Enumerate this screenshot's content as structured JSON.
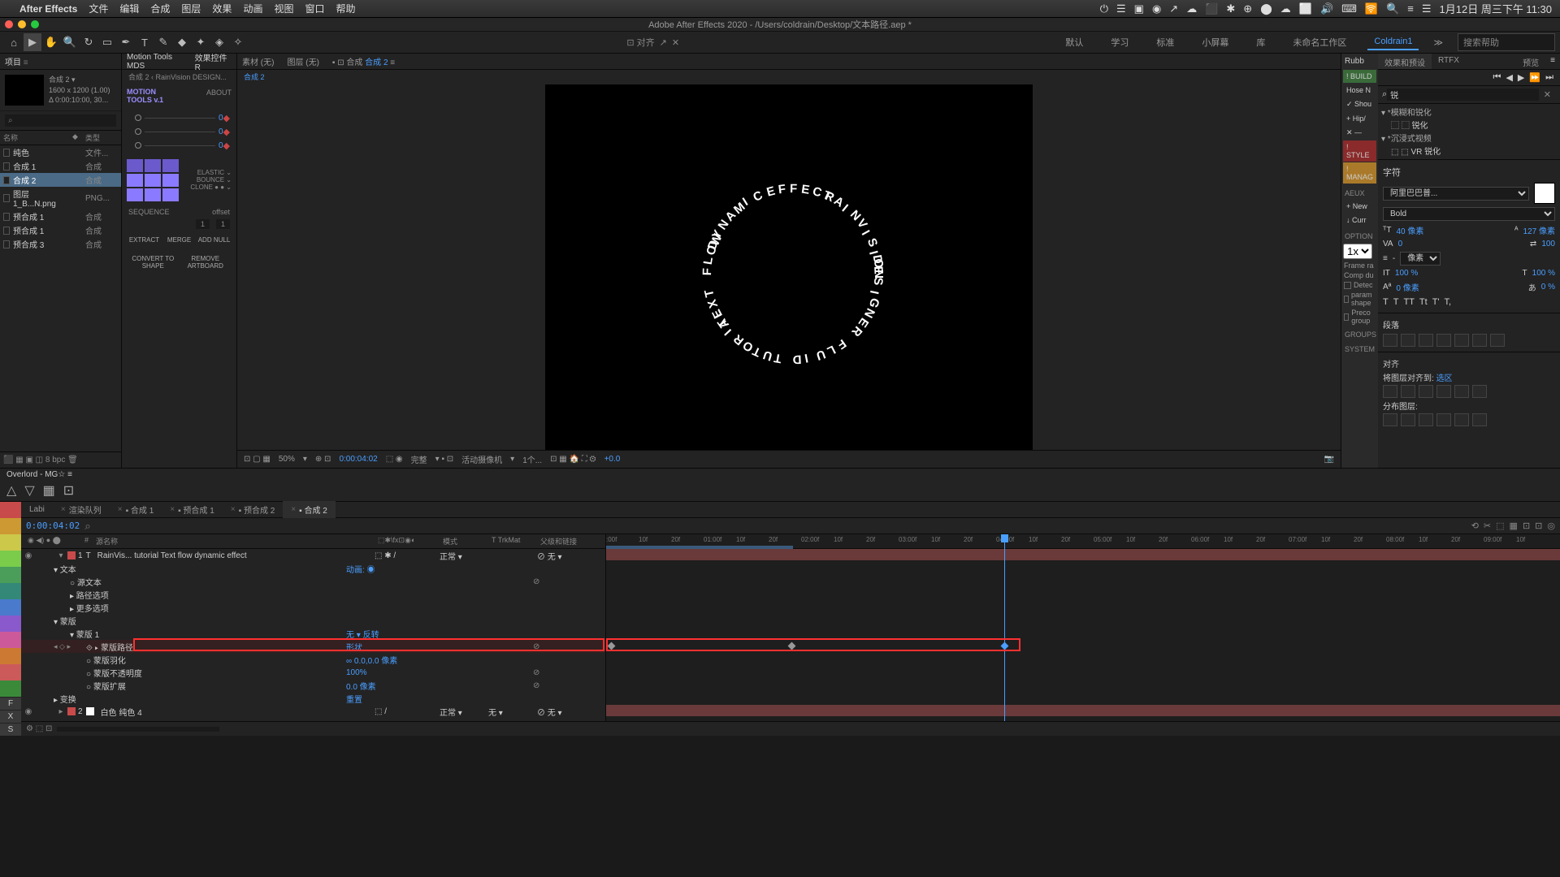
{
  "mac": {
    "app": "After Effects",
    "menus": [
      "文件",
      "编辑",
      "合成",
      "图层",
      "效果",
      "动画",
      "视图",
      "窗口",
      "帮助"
    ],
    "status_right": [
      "⏻",
      "☰",
      "▣",
      "⚙",
      "◉",
      "↗",
      "☁",
      "⬛",
      "✱",
      "⊕",
      "⬤",
      "☁",
      "⬜",
      "🔊",
      "⌨",
      "🛜",
      "🔍",
      "≡",
      "☰"
    ],
    "clock": "1月12日 周三下午 11:30"
  },
  "title": "Adobe After Effects 2020 - /Users/coldrain/Desktop/文本路径.aep *",
  "tools": [
    "⌂",
    "▶",
    "✋",
    "🔍",
    "↻",
    "▭",
    "✒",
    "T",
    "✎",
    "◆",
    "✦",
    "◈",
    "✧",
    "⬚"
  ],
  "tool_center": {
    "align": "⊡ 对齐",
    "a": "↗",
    "b": "✕"
  },
  "workspaces": [
    "默认",
    "学习",
    "标准",
    "小屏幕",
    "库",
    "未命名工作区",
    "Coldrain1"
  ],
  "search_ph": "搜索帮助",
  "project": {
    "tab1": "项目",
    "tab2": "效果控件 R",
    "comp_name": "合成 2 ▾",
    "res": "1600 x 1200 (1.00)",
    "dur": "Δ 0:00:10:00, 30...",
    "search_ph": "⌕",
    "cols": [
      "名称",
      "◆",
      "类型"
    ],
    "items": [
      {
        "name": "纯色",
        "type": "文件..."
      },
      {
        "name": "合成 1",
        "type": "合成"
      },
      {
        "name": "合成 2",
        "type": "合成",
        "sel": true
      },
      {
        "name": "图层 1_B...N.png",
        "type": "PNG..."
      },
      {
        "name": "预合成 1",
        "type": "合成"
      },
      {
        "name": "预合成 1",
        "type": "合成"
      },
      {
        "name": "预合成 3",
        "type": "合成"
      }
    ],
    "footer": "⬛ ▦ ▣ ◫   8 bpc   🗑"
  },
  "motion": {
    "title": "Motion Tools MDS",
    "logo1": "MOTION",
    "logo2": "TOOLS v.1",
    "about": "ABOUT",
    "sliders": [
      0,
      0,
      0
    ],
    "labels": [
      "ELASTIC ⌄",
      "BOUNCE ⌄",
      "CLONE  ● ● ⌄"
    ],
    "seq": "SEQUENCE",
    "offset": "offset",
    "off_vals": [
      "1",
      "1"
    ],
    "bot": [
      "EXTRACT",
      "MERGE",
      "ADD NULL"
    ],
    "conv": [
      "CONVERT TO SHAPE",
      "REMOVE ARTBOARD"
    ]
  },
  "viewer": {
    "tabs": [
      {
        "label": "素材",
        "sub": "(无)"
      },
      {
        "label": "图层",
        "sub": "(无)"
      },
      {
        "label": "▪ ⊡ 合成",
        "sub": "合成 2",
        "active": true
      }
    ],
    "flow": "合成 2 ‹ RainVision      DESIGN...",
    "flow_main": "合成 2",
    "footer": {
      "icons1": "⊡ ▢ ▦",
      "zoom": "50%",
      "tc": "0:00:04:02",
      "res": "完整",
      "cam": "活动摄像机",
      "views": "1个...",
      "icons2": "⊡ ▦ 🏠 ⛶ ⚙",
      "exp": "+0.0"
    }
  },
  "circle_words": [
    "RAINVISION",
    "DESIGNER",
    "FLUID",
    "TUTORIAL",
    "TEXT FLOW",
    "DYNAMIC",
    "EFFECT"
  ],
  "right": {
    "rubb": "Rubb",
    "tabs": [
      "效果和预设",
      "RTFX",
      "预览"
    ],
    "search": "锐",
    "tree_group": "▾ *模糊和锐化",
    "tree_items": [
      "⬚ ⬚ 锐化",
      "▾ *沉浸式视频",
      "⬚ ⬚ VR 锐化"
    ],
    "preview_icons": [
      "⏮",
      "◀",
      "▶",
      "⏩",
      "⏭"
    ],
    "extra_tags": [
      {
        "t": "! BUILD",
        "c": "green"
      },
      {
        "t": "Hose N",
        "c": ""
      },
      {
        "t": "✓ Shou",
        "c": ""
      },
      {
        "t": "+ Hip/",
        "c": ""
      },
      {
        "t": "✕  —",
        "c": ""
      },
      {
        "t": "! STYLE",
        "c": "red"
      },
      {
        "t": "! MANAG",
        "c": "orange"
      }
    ],
    "aeux": "AEUX",
    "aeux_items": [
      "+ New",
      "↓ Curr"
    ],
    "option": "OPTION",
    "fps_sel": "1x",
    "opts": [
      "Frame ra",
      "Comp du",
      "Detec",
      "param shape",
      "Preco group"
    ],
    "groups": "GROUPS",
    "system": "SYSTEM",
    "char_title": "字符",
    "font": "阿里巴巴普...",
    "weight": "Bold",
    "size": "40 像素",
    "leading": "127 像素",
    "kern": "0",
    "tracking": "100",
    "scale_v": "100 %",
    "scale_h": "100 %",
    "baseline": "0 像素",
    "pct": "0 %",
    "unit": "像素",
    "styles": [
      "T",
      "T",
      "TT",
      "Tt",
      "T'",
      "T,"
    ],
    "para_title": "段落",
    "align_title": "对齐",
    "align_label": "将图层对齐到:",
    "align_val": "选区",
    "dist_label": "分布图层:"
  },
  "overlord": {
    "title": "Overlord - MG☆ ≡"
  },
  "timeline": {
    "tabs": [
      "Labi",
      "渲染队列",
      "合成 1",
      "预合成 1",
      "预合成 2",
      "合成 2"
    ],
    "active_tab": 5,
    "tc": "0:00:04:02",
    "search_ph": "⌕",
    "tool_icons": [
      "⟲",
      "✂",
      "⬚",
      "▦",
      "⊡",
      "⊡",
      "◎"
    ],
    "cols_l": [
      "◉ ◀) ● ⬤",
      "#",
      "源名称"
    ],
    "cols_m": [
      "⬚✱\\fx⊡◉◐",
      "模式",
      "T  TrkMat",
      "父级和链接"
    ],
    "layer1": {
      "num": "1",
      "name": "RainVis...    tutorial    Text flow  dynamic  effect",
      "mode": "正常",
      "parent": "无"
    },
    "props": [
      {
        "name": "▾  文本",
        "val": "动画: ◉",
        "i": 1
      },
      {
        "name": "○ 源文本",
        "i": 2,
        "kf": "◇"
      },
      {
        "name": "▸ 路径选项",
        "i": 2
      },
      {
        "name": "▸ 更多选项",
        "i": 2
      },
      {
        "name": "▾ 蒙版",
        "i": 1
      },
      {
        "name": "▾ 蒙版 1",
        "val": "无        ▾ 反转",
        "i": 2
      },
      {
        "name": "⟐ ▸ 蒙版路径",
        "val": "形状...",
        "i": 3,
        "hl": true,
        "kf": "◇"
      },
      {
        "name": "○ 蒙版羽化",
        "val": "∞ 0.0,0.0 像素",
        "i": 3
      },
      {
        "name": "○ 蒙版不透明度",
        "val": "100%",
        "i": 3,
        "kf": "◇"
      },
      {
        "name": "○ 蒙版扩展",
        "val": "0.0 像素",
        "i": 3,
        "kf": "◇"
      },
      {
        "name": "▸ 变换",
        "val": "重置",
        "i": 1
      }
    ],
    "layer2": {
      "num": "2",
      "name": "白色 纯色 4",
      "mode": "正常",
      "trk": "无",
      "parent": "无"
    },
    "ruler_ticks": [
      ":00f",
      "10f",
      "20f",
      "01:00f",
      "10f",
      "20f",
      "02:00f",
      "10f",
      "20f",
      "03:00f",
      "10f",
      "20f",
      "04:00f",
      "10f",
      "20f",
      "05:00f",
      "10f",
      "20f",
      "06:00f",
      "10f",
      "20f",
      "07:00f",
      "10f",
      "20f",
      "08:00f",
      "10f",
      "20f",
      "09:00f",
      "10f"
    ],
    "label_colors": [
      "#c94a4a",
      "#cc9933",
      "#ccc84a",
      "#7acc4a",
      "#4a9e5a",
      "#338877",
      "#4a7acc",
      "#8a5acc",
      "#cc5a9a",
      "#cc7a33",
      "#cc5a5a",
      "#3a8a3a"
    ]
  }
}
